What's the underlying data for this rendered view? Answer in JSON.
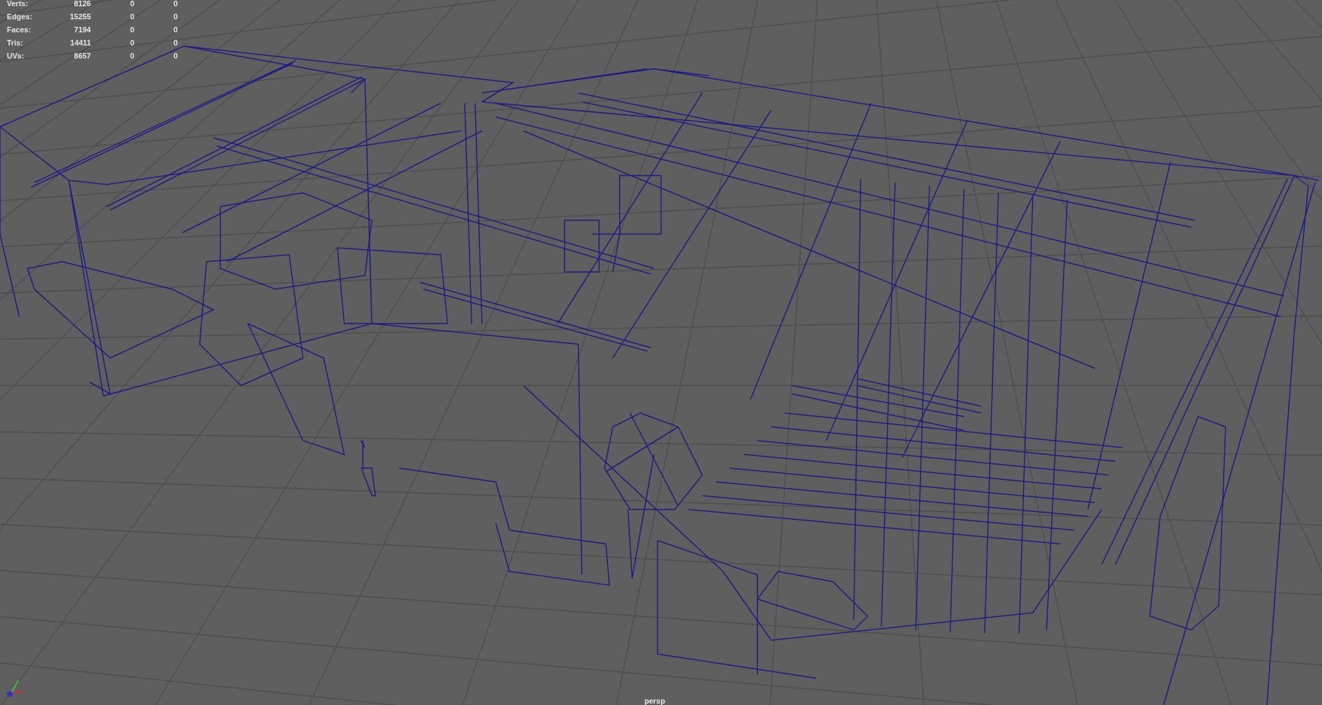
{
  "hud": [
    {
      "label": "Verts:",
      "values": [
        "8126",
        "0",
        "0"
      ]
    },
    {
      "label": "Edges:",
      "values": [
        "15255",
        "0",
        "0"
      ]
    },
    {
      "label": "Faces:",
      "values": [
        "7194",
        "0",
        "0"
      ]
    },
    {
      "label": "Tris:",
      "values": [
        "14411",
        "0",
        "0"
      ]
    },
    {
      "label": "UVs:",
      "values": [
        "8657",
        "0",
        "0"
      ]
    }
  ],
  "camera": "persp"
}
